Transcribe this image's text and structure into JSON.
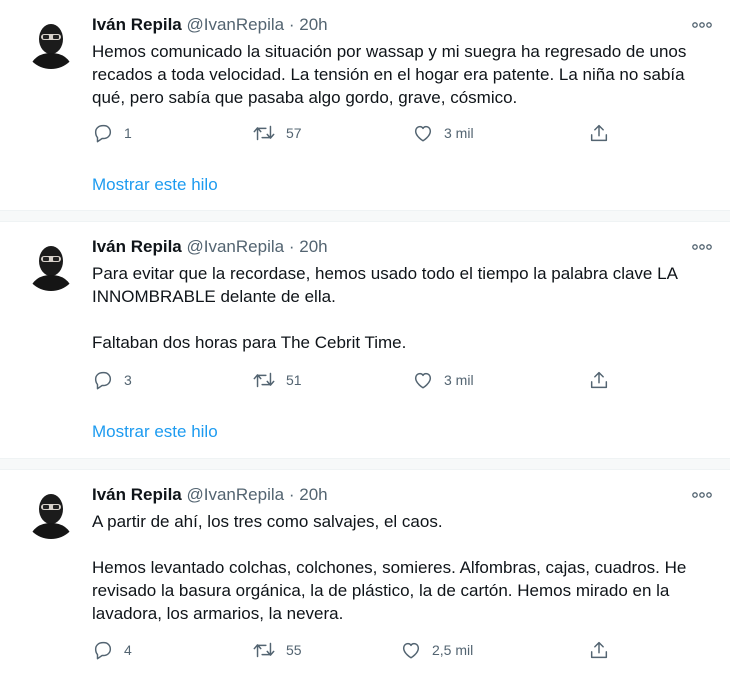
{
  "tweets": [
    {
      "author": "Iván Repila",
      "handle": "@IvanRepila",
      "separator": "·",
      "time": "20h",
      "paragraphs": [
        "Hemos comunicado la situación por wassap y mi suegra ha regresado de unos recados a toda velocidad. La tensión en el hogar era patente. La niña no sabía qué, pero sabía que pasaba algo gordo, grave, cósmico."
      ],
      "replies": "1",
      "retweets": "57",
      "likes": "3 mil",
      "show_thread": "Mostrar este hilo"
    },
    {
      "author": "Iván Repila",
      "handle": "@IvanRepila",
      "separator": "·",
      "time": "20h",
      "paragraphs": [
        "Para evitar que la recordase, hemos usado todo el tiempo la palabra clave LA INNOMBRABLE delante de ella.",
        "Faltaban dos horas para The Cebrit Time."
      ],
      "replies": "3",
      "retweets": "51",
      "likes": "3 mil",
      "show_thread": "Mostrar este hilo"
    },
    {
      "author": "Iván Repila",
      "handle": "@IvanRepila",
      "separator": "·",
      "time": "20h",
      "paragraphs": [
        "A partir de ahí, los tres como salvajes, el caos.",
        "Hemos levantado colchas, colchones, somieres. Alfombras, cajas, cuadros. He revisado la basura orgánica, la de plástico, la de cartón. Hemos mirado en la lavadora, los armarios, la nevera."
      ],
      "replies": "4",
      "retweets": "55",
      "likes": "2,5 mil"
    }
  ],
  "icons": {
    "avatar": "avatar-photo",
    "more": "more-icon",
    "reply": "reply-icon",
    "retweet": "retweet-icon",
    "like": "like-icon",
    "share": "share-icon"
  },
  "colors": {
    "link": "#1d9bf0",
    "secondary_text": "#536471",
    "separator_bg": "#f7f9f9"
  }
}
